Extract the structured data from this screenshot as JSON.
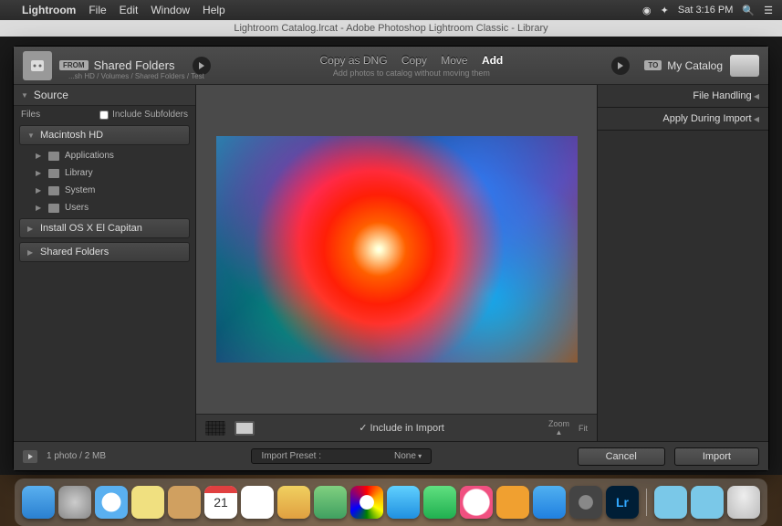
{
  "menubar": {
    "app": "Lightroom",
    "items": [
      "File",
      "Edit",
      "Window",
      "Help"
    ],
    "clock": "Sat 3:16 PM"
  },
  "window": {
    "title": "Lightroom Catalog.lrcat - Adobe Photoshop Lightroom Classic - Library"
  },
  "header": {
    "from_badge": "FROM",
    "source_label": "Shared Folders",
    "source_path": "...sh HD / Volumes / Shared Folders / Test",
    "actions": {
      "copy_dng": "Copy as DNG",
      "copy": "Copy",
      "move": "Move",
      "add": "Add"
    },
    "subtitle": "Add photos to catalog without moving them",
    "to_badge": "TO",
    "dest_label": "My Catalog"
  },
  "left": {
    "panel_title": "Source",
    "files_label": "Files",
    "include_sub": "Include Subfolders",
    "root": "Macintosh HD",
    "children": [
      "Applications",
      "Library",
      "System",
      "Users"
    ],
    "extra": [
      "Install OS X El Capitan",
      "Shared Folders"
    ]
  },
  "center": {
    "include_label": "Include in Import",
    "zoom_label": "Zoom",
    "fit_label": "Fit"
  },
  "right": {
    "file_handling": "File Handling",
    "apply_during": "Apply During Import"
  },
  "footer": {
    "status": "1 photo / 2 MB",
    "preset_label": "Import Preset :",
    "preset_value": "None",
    "cancel": "Cancel",
    "import": "Import"
  }
}
